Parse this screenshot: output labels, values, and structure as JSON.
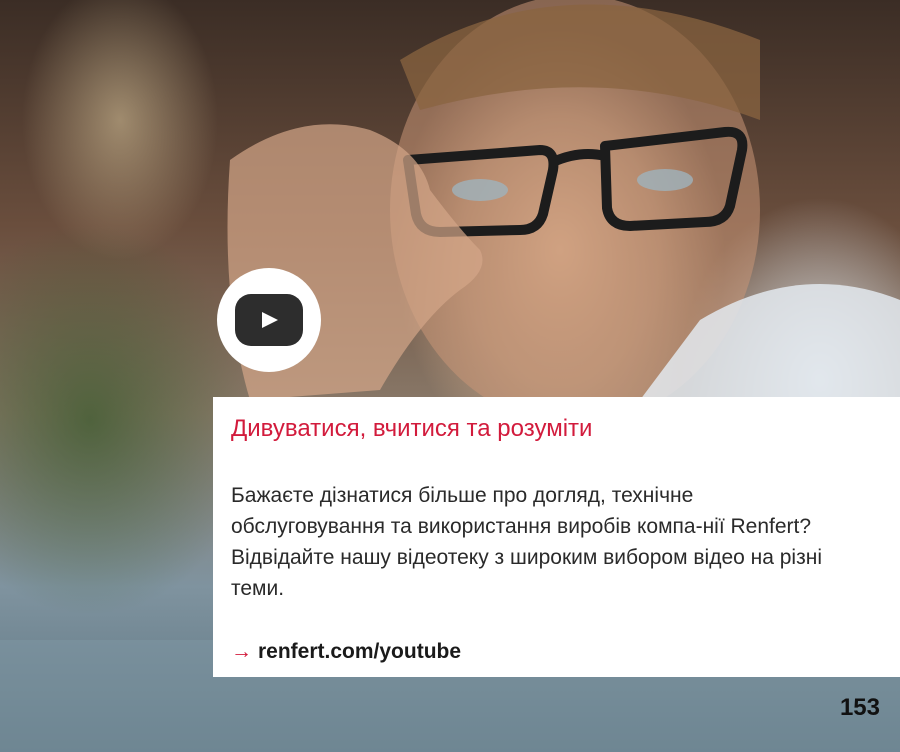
{
  "card": {
    "title": "Дивуватися, вчитися та розуміти",
    "body": "Бажаєте дізнатися більше про догляд, технічне обслуговування та використання виробів компа-нії Renfert? Відвідайте нашу відеотеку з широким вибором відео на різні теми.",
    "link_arrow": "→",
    "link_text": "renfert.com/youtube"
  },
  "page_number": "153",
  "icons": {
    "video": "youtube-play-icon"
  },
  "colors": {
    "accent": "#d21b3c",
    "card_background": "#ffffff",
    "text": "#2a2a2a"
  }
}
